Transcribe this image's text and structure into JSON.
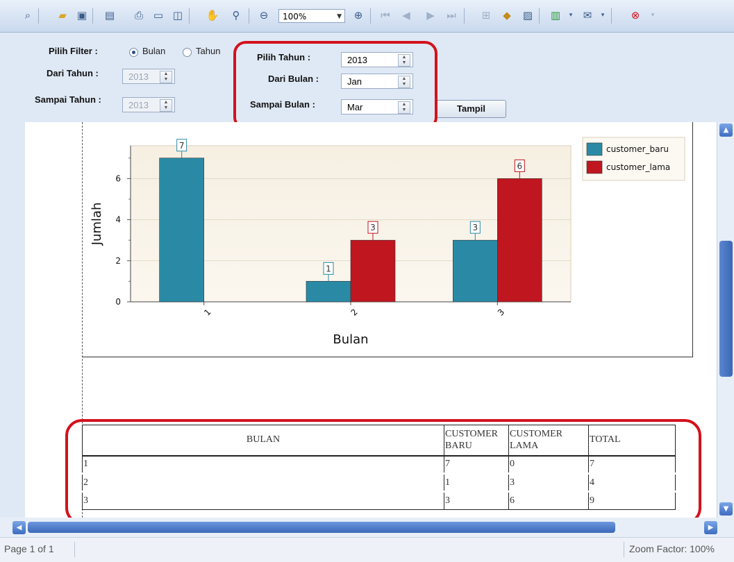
{
  "toolbar": {
    "zoom_value": "100%",
    "icons": [
      "binoculars-icon",
      "open-folder-icon",
      "save-icon",
      "page-setup-icon",
      "print-icon",
      "quick-print-icon",
      "export-icon",
      "hand-tool-icon",
      "magnifier-icon",
      "zoom-out-icon",
      "zoom-in-icon",
      "first-page-icon",
      "previous-page-icon",
      "next-page-icon",
      "last-page-icon",
      "multiple-pages-icon",
      "background-color-icon",
      "watermark-icon",
      "export-document-icon",
      "send-email-icon",
      "close-preview-icon"
    ]
  },
  "filter": {
    "pilih_filter_label": "Pilih Filter  :",
    "radio_bulan": "Bulan",
    "radio_tahun": "Tahun",
    "dari_tahun_label": "Dari Tahun :",
    "dari_tahun_value": "2013",
    "sampai_tahun_label": "Sampai Tahun :",
    "sampai_tahun_value": "2013",
    "pilih_tahun_label": "Pilih Tahun  :",
    "pilih_tahun_value": "2013",
    "dari_bulan_label": "Dari Bulan :",
    "dari_bulan_value": "Jan",
    "sampai_bulan_label": "Sampai Bulan :",
    "sampai_bulan_value": "Mar",
    "tampil_button": "Tampil"
  },
  "chart_data": {
    "type": "bar",
    "categories": [
      "1",
      "2",
      "3"
    ],
    "series": [
      {
        "name": "customer_baru",
        "values": [
          7,
          1,
          3
        ],
        "color": "#2a8aa6"
      },
      {
        "name": "customer_lama",
        "values": [
          0,
          3,
          6
        ],
        "color": "#c0161f"
      }
    ],
    "xlabel": "Bulan",
    "ylabel": "Jumlah",
    "yticks": [
      0,
      2,
      4,
      6
    ],
    "ylim": [
      0,
      7.6
    ],
    "legend": "top-right",
    "grid": true
  },
  "table": {
    "headers": [
      "BULAN",
      "CUSTOMER BARU",
      "CUSTOMER LAMA",
      "TOTAL"
    ],
    "rows": [
      [
        "1",
        "7",
        "0",
        "7"
      ],
      [
        "2",
        "1",
        "3",
        "4"
      ],
      [
        "3",
        "3",
        "6",
        "9"
      ]
    ]
  },
  "status": {
    "page": "Page 1 of 1",
    "zoom_factor": "Zoom Factor: 100%"
  }
}
